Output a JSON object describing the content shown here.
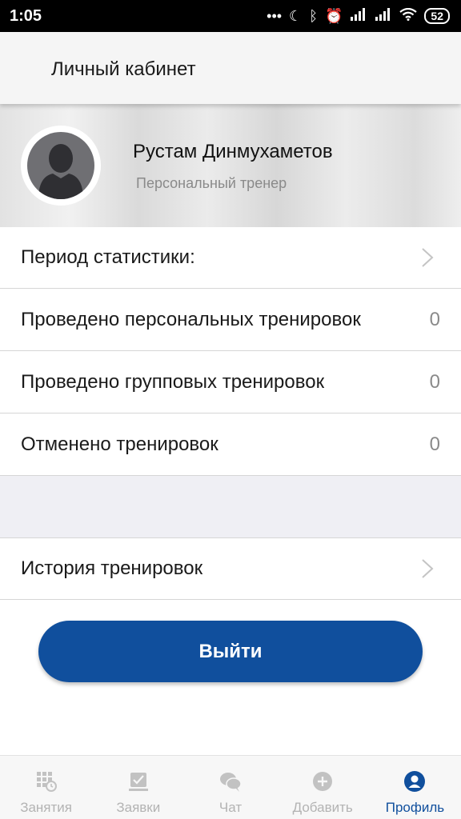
{
  "status_bar": {
    "time": "1:05",
    "battery": "52"
  },
  "header": {
    "title": "Личный кабинет"
  },
  "profile": {
    "name": "Рустам Динмухаметов",
    "role": "Персональный тренер"
  },
  "stats": {
    "period_label": "Период статистики:",
    "rows": [
      {
        "label": "Проведено персональных тренировок",
        "value": "0"
      },
      {
        "label": "Проведено групповых тренировок",
        "value": "0"
      },
      {
        "label": "Отменено тренировок",
        "value": "0"
      }
    ]
  },
  "history": {
    "label": "История тренировок"
  },
  "logout": {
    "label": "Выйти"
  },
  "tabs": [
    {
      "label": "Занятия",
      "icon": "calendar-clock-icon",
      "active": false
    },
    {
      "label": "Заявки",
      "icon": "checklist-icon",
      "active": false
    },
    {
      "label": "Чат",
      "icon": "chat-bubbles-icon",
      "active": false
    },
    {
      "label": "Добавить",
      "icon": "plus-circle-icon",
      "active": false
    },
    {
      "label": "Профиль",
      "icon": "profile-icon",
      "active": true
    }
  ],
  "colors": {
    "accent": "#104f9d",
    "inactive_tab": "#b3b3b3",
    "section_gap": "#efeff4"
  }
}
